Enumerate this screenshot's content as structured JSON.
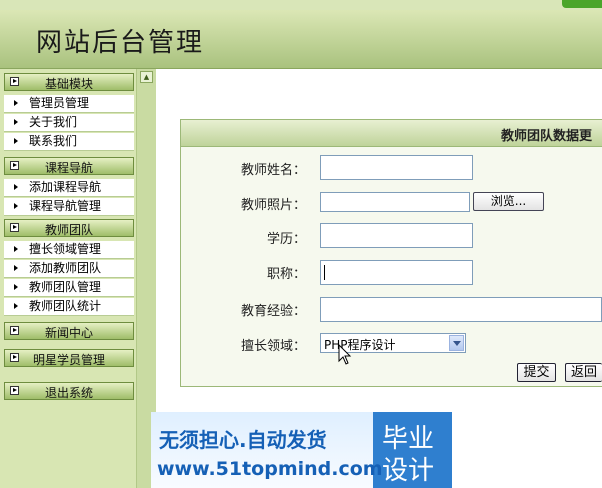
{
  "header": {
    "title": "网站后台管理"
  },
  "sidebar": {
    "groups": [
      {
        "label": "基础模块",
        "items": [
          "管理员管理",
          "关于我们",
          "联系我们"
        ]
      },
      {
        "label": "课程导航",
        "items": [
          "添加课程导航",
          "课程导航管理"
        ]
      },
      {
        "label": "教师团队",
        "items": [
          "擅长领域管理",
          "添加教师团队",
          "教师团队管理",
          "教师团队统计"
        ]
      },
      {
        "label": "新闻中心",
        "items": []
      },
      {
        "label": "明星学员管理",
        "items": []
      },
      {
        "label": "退出系统",
        "items": []
      }
    ]
  },
  "form": {
    "title": "教师团队数据更",
    "fields": {
      "name": "教师姓名：",
      "photo": "教师照片：",
      "education": "学历：",
      "title": "职称：",
      "experience": "教育经验：",
      "specialty": "擅长领域："
    },
    "browse_label": "浏览...",
    "specialty_selected": "PHP程序设计",
    "submit_label": "提交",
    "back_label": "返回"
  },
  "ad": {
    "line1": "无须担心.自动发货",
    "line2": "www.51topmind.com",
    "right1": "毕业",
    "right2": "设计"
  }
}
